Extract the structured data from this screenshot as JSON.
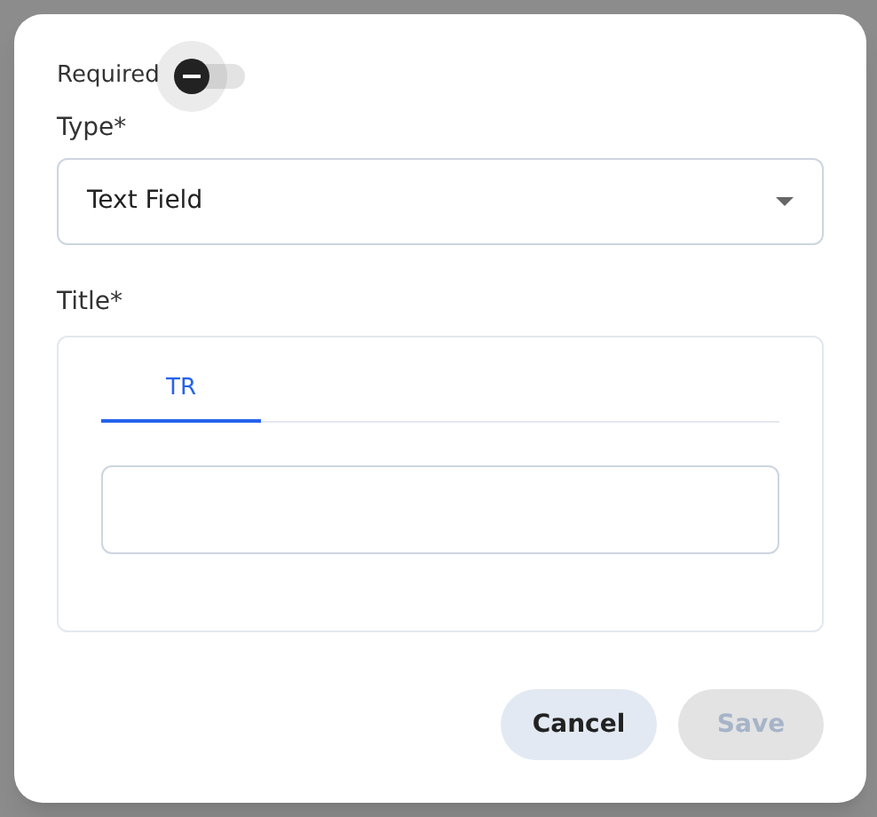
{
  "dialog": {
    "required": {
      "label": "Required",
      "on": false
    },
    "type_field": {
      "label": "Type*",
      "value": "Text Field"
    },
    "title_field": {
      "label": "Title*",
      "tabs": [
        {
          "label": "TR",
          "selected": true
        }
      ]
    },
    "buttons": [
      {
        "label": "Cancel",
        "kind": "secondary",
        "disabled": false
      },
      {
        "label": "Save",
        "kind": "primary",
        "disabled": true
      }
    ]
  }
}
